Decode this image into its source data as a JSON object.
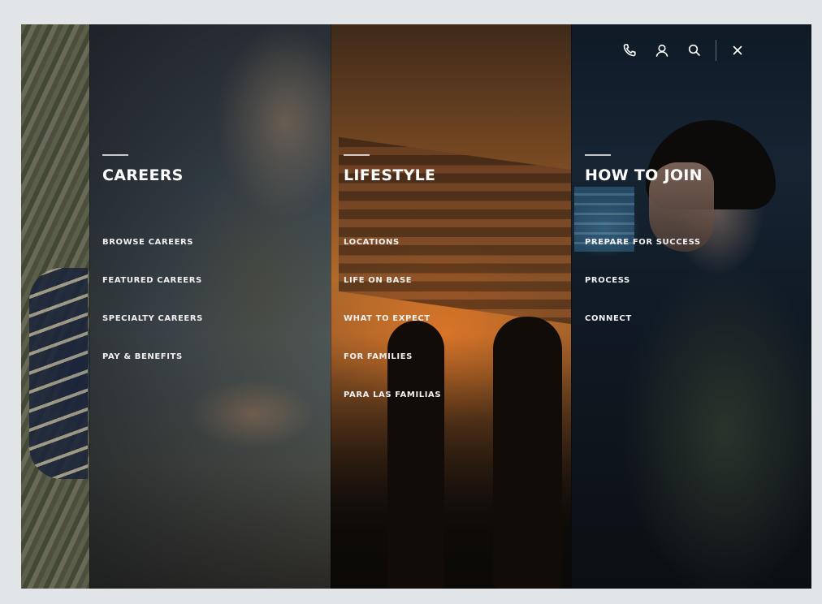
{
  "utility_bar": {
    "icons": [
      "phone-icon",
      "user-icon",
      "search-icon",
      "close-icon"
    ]
  },
  "menu": {
    "careers": {
      "title": "CAREERS",
      "links": [
        "BROWSE CAREERS",
        "FEATURED CAREERS",
        "SPECIALTY CAREERS",
        "PAY & BENEFITS"
      ]
    },
    "lifestyle": {
      "title": "LIFESTYLE",
      "links": [
        "LOCATIONS",
        "LIFE ON BASE",
        "WHAT TO EXPECT",
        "FOR FAMILIES",
        "PARA LAS FAMILIAS"
      ]
    },
    "how_to_join": {
      "title": "HOW TO JOIN",
      "links": [
        "PREPARE FOR SUCCESS",
        "PROCESS",
        "CONNECT"
      ]
    }
  },
  "colors": {
    "page_background": "#e1e5e7",
    "text": "#ffffff",
    "lifestyle_accent": "#b06a2c"
  }
}
